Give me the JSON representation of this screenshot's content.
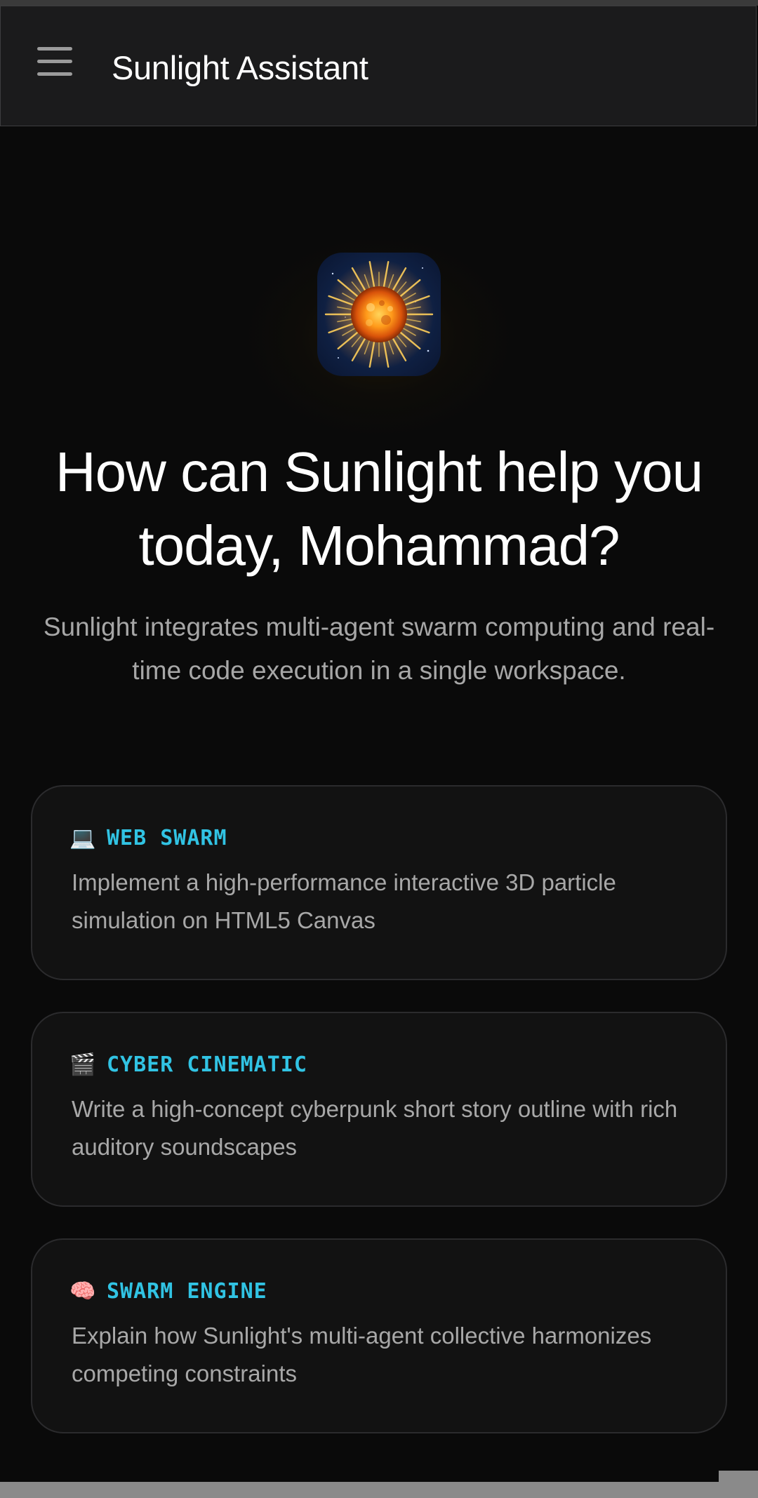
{
  "header": {
    "title": "Sunlight Assistant",
    "menu_icon": "hamburger-menu-icon"
  },
  "hero": {
    "logo": "sun-logo",
    "headline": "How can Sunlight help you today, Mohammad?",
    "subtitle": "Sunlight integrates multi-agent swarm computing and real-time code execution in a single workspace."
  },
  "cards": [
    {
      "icon": "laptop-icon",
      "emoji": "💻",
      "label": "WEB SWARM",
      "text": "Implement a high-performance interactive 3D particle simulation on HTML5 Canvas"
    },
    {
      "icon": "clapperboard-icon",
      "emoji": "🎬",
      "label": "CYBER CINEMATIC",
      "text": "Write a high-concept cyberpunk short story outline with rich auditory soundscapes"
    },
    {
      "icon": "brain-icon",
      "emoji": "🧠",
      "label": "SWARM ENGINE",
      "text": "Explain how Sunlight's multi-agent collective harmonizes competing constraints"
    }
  ],
  "colors": {
    "background": "#0a0a0a",
    "header": "#1b1b1c",
    "card_background": "#121212",
    "card_border": "#2b2b2d",
    "accent": "#31c3e3",
    "muted_text": "#a8a8a8"
  }
}
